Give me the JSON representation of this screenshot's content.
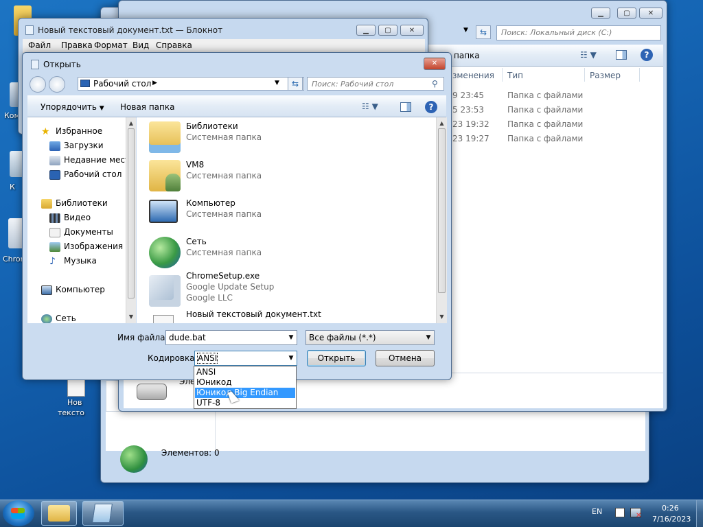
{
  "desktop": {
    "icon_labels": [
      "Ком",
      "К",
      "Chrom",
      "Нов",
      "тексто"
    ]
  },
  "explorer": {
    "search_placeholder": "Поиск: Локальный диск (C:)",
    "partial_toolbar": "папка",
    "columns": [
      "зменения",
      "Тип",
      "Размер"
    ],
    "rows": [
      {
        "date": "9 23:45",
        "type": "Папка с файлами"
      },
      {
        "date": "5 23:53",
        "type": "Папка с файлами"
      },
      {
        "date": "23 19:32",
        "type": "Папка с файлами"
      },
      {
        "date": "23 19:27",
        "type": "Папка с файлами"
      }
    ],
    "details_label": "Элем"
  },
  "background_explorer": {
    "status": "Элементов: 0"
  },
  "notepad": {
    "title": "Новый текстовый документ.txt — Блокнот",
    "menu": [
      "Файл",
      "Правка",
      "Формат",
      "Вид",
      "Справка"
    ]
  },
  "dialog": {
    "title": "Открыть",
    "address": "Рабочий стол",
    "search_placeholder": "Поиск: Рабочий стол",
    "organize": "Упорядочить",
    "new_folder": "Новая папка",
    "nav": [
      {
        "label": "Избранное",
        "icon": "star-icon",
        "level": 0
      },
      {
        "label": "Загрузки",
        "icon": "downloads-icon",
        "level": 1
      },
      {
        "label": "Недавние места",
        "icon": "recent-places-icon",
        "level": 1
      },
      {
        "label": "Рабочий стол",
        "icon": "desktop-icon",
        "level": 1
      },
      {
        "label": "Библиотеки",
        "icon": "libraries-icon",
        "level": 0
      },
      {
        "label": "Видео",
        "icon": "video-icon",
        "level": 1
      },
      {
        "label": "Документы",
        "icon": "documents-icon",
        "level": 1
      },
      {
        "label": "Изображения",
        "icon": "pictures-icon",
        "level": 1
      },
      {
        "label": "Музыка",
        "icon": "music-icon",
        "level": 1
      },
      {
        "label": "Компьютер",
        "icon": "computer-icon",
        "level": 0
      },
      {
        "label": "Сеть",
        "icon": "network-icon",
        "level": 0
      }
    ],
    "files": [
      {
        "name": "Библиотеки",
        "sub": "Системная папка",
        "sub2": "",
        "icon": "libraries-folder-icon"
      },
      {
        "name": "VM8",
        "sub": "Системная папка",
        "sub2": "",
        "icon": "user-folder-icon"
      },
      {
        "name": "Компьютер",
        "sub": "Системная папка",
        "sub2": "",
        "icon": "computer-icon"
      },
      {
        "name": "Сеть",
        "sub": "Системная папка",
        "sub2": "",
        "icon": "network-icon"
      },
      {
        "name": "ChromeSetup.exe",
        "sub": "Google Update Setup",
        "sub2": "Google LLC",
        "icon": "installer-icon"
      },
      {
        "name": "Новый текстовый документ.txt",
        "sub": "",
        "sub2": "",
        "icon": "text-file-icon"
      }
    ],
    "filename_label": "Имя файла:",
    "filename_value": "dude.bat",
    "filetype_value": "Все файлы  (*.*)",
    "encoding_label": "Кодировка:",
    "encoding_value": "ANSI",
    "encoding_options": [
      "ANSI",
      "Юникод",
      "Юникод Big Endian",
      "UTF-8"
    ],
    "encoding_highlighted": "Юникод Big Endian",
    "open_button": "Открыть",
    "cancel_button": "Отмена"
  },
  "taskbar": {
    "language": "EN",
    "time": "0:26",
    "date": "7/16/2023"
  }
}
